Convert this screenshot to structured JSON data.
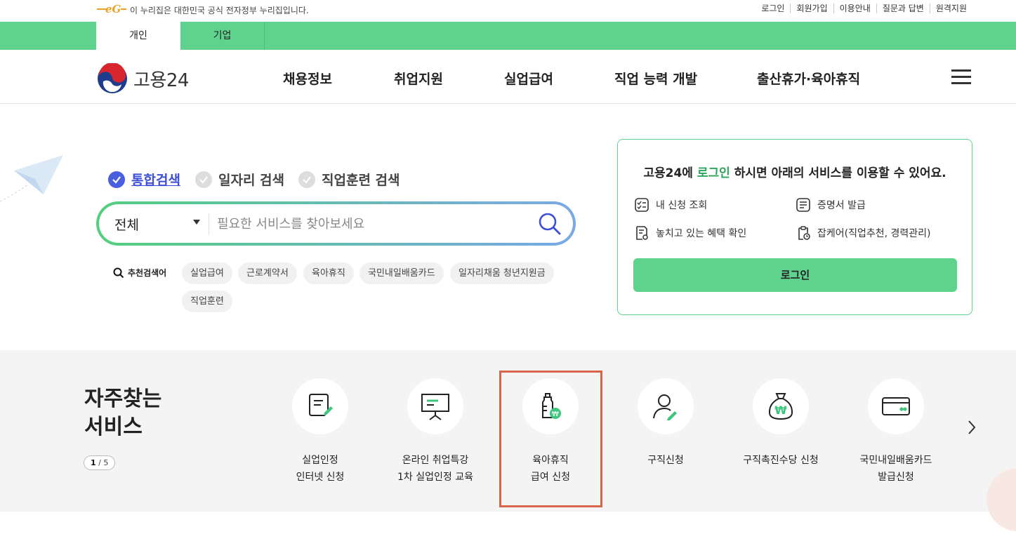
{
  "notice": {
    "logo_text": "eG",
    "message": "이 누리집은 대한민국 공식 전자정부 누리집입니다.",
    "links": [
      "로그인",
      "회원가입",
      "이용안내",
      "질문과 답변",
      "원격지원"
    ]
  },
  "tabs": [
    {
      "label": "개인",
      "active": true
    },
    {
      "label": "기업",
      "active": false
    }
  ],
  "header": {
    "brand": "고용24",
    "menu": [
      "채용정보",
      "취업지원",
      "실업급여",
      "직업 능력 개발",
      "출산휴가·육아휴직"
    ]
  },
  "search": {
    "modes": [
      {
        "label": "통합검색",
        "selected": true
      },
      {
        "label": "일자리 검색",
        "selected": false
      },
      {
        "label": "직업훈련 검색",
        "selected": false
      }
    ],
    "category": "전체",
    "placeholder": "필요한 서비스를 찾아보세요",
    "recommend_label": "추천검색어",
    "keywords": [
      "실업급여",
      "근로계약서",
      "육아휴직",
      "국민내일배움카드",
      "일자리채움 청년지원금",
      "직업훈련"
    ]
  },
  "login_card": {
    "message_prefix": "고용24에 ",
    "message_highlight": "로그인",
    "message_suffix": " 하시면 아래의 서비스를 이용할 수 있어요.",
    "services": [
      "내 신청 조회",
      "증명서 발급",
      "놓치고 있는 혜택 확인",
      "잡케어(직업추천, 경력관리)"
    ],
    "button": "로그인"
  },
  "frequent": {
    "title_line1": "자주찾는",
    "title_line2": "서비스",
    "page_current": "1",
    "page_total": "5",
    "items": [
      {
        "line1": "실업인정",
        "line2": "인터넷 신청",
        "icon": "document-edit-icon"
      },
      {
        "line1": "온라인 취업특강",
        "line2": "1차 실업인정 교육",
        "icon": "presentation-board-icon"
      },
      {
        "line1": "육아휴직",
        "line2": "급여 신청",
        "icon": "baby-bottle-icon"
      },
      {
        "line1": "구직신청",
        "line2": "",
        "icon": "person-edit-icon"
      },
      {
        "line1": "구직촉진수당 신청",
        "line2": "",
        "icon": "money-bag-icon"
      },
      {
        "line1": "국민내일배움카드",
        "line2": "발급신청",
        "icon": "card-icon"
      }
    ]
  },
  "colors": {
    "accent_green": "#5fd38e",
    "highlight_green": "#2da45b",
    "search_blue": "#4a5fe0",
    "annotation_red": "#d9654a"
  }
}
